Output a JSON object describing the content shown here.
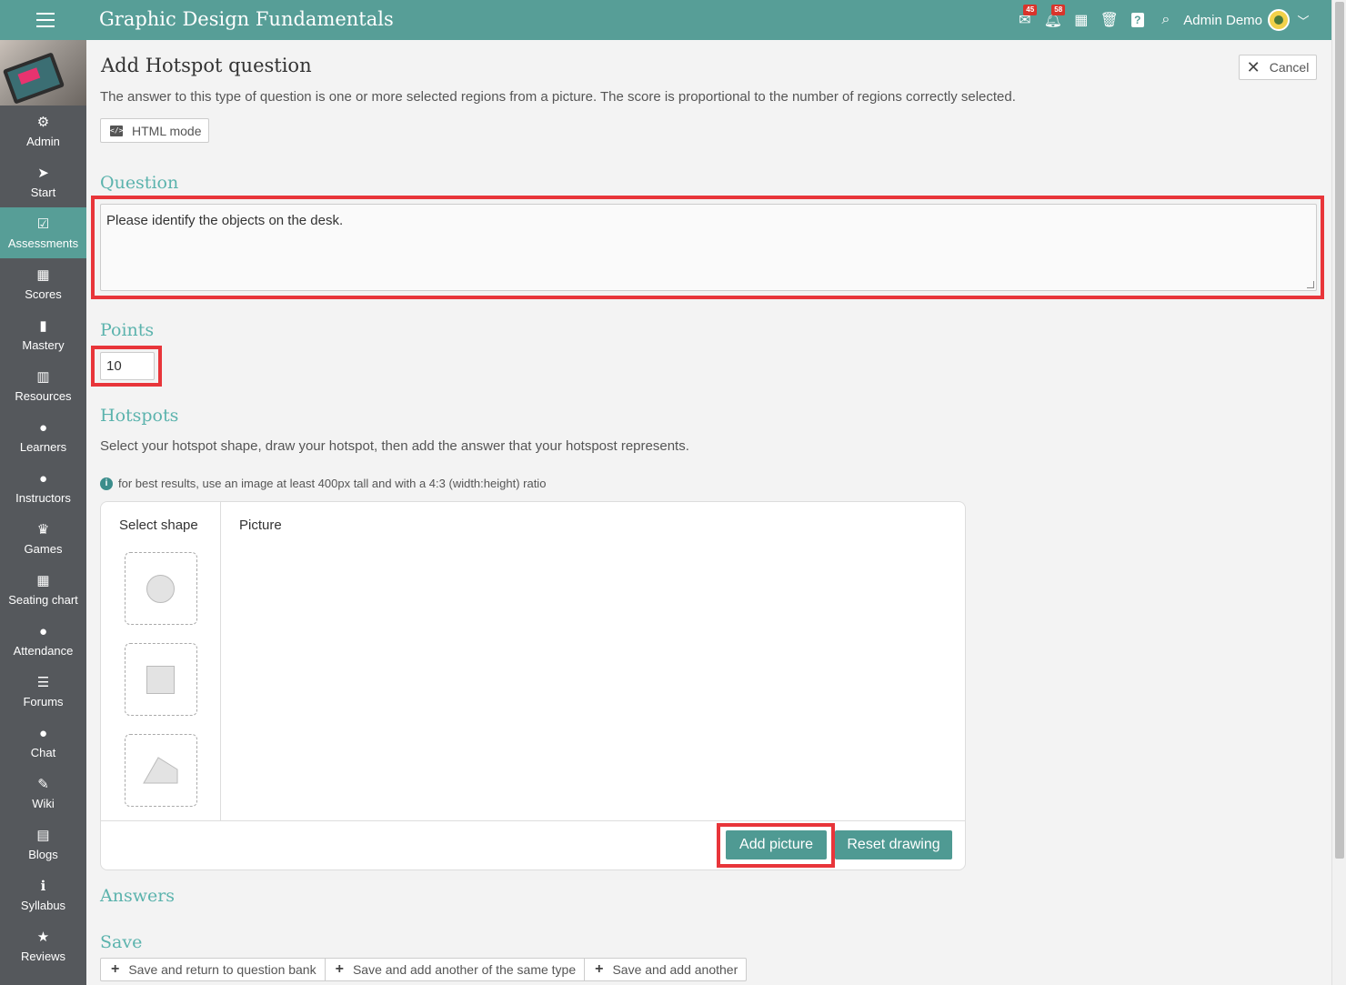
{
  "app": {
    "title": "Graphic Design Fundamentals",
    "user_name": "Admin Demo",
    "badges": {
      "messages": "45",
      "notifications": "58"
    }
  },
  "sidebar": {
    "items": [
      {
        "label": "Admin",
        "icon": "⚙"
      },
      {
        "label": "Start",
        "icon": "➤"
      },
      {
        "label": "Assessments",
        "icon": "☑"
      },
      {
        "label": "Scores",
        "icon": "▦"
      },
      {
        "label": "Mastery",
        "icon": "▮"
      },
      {
        "label": "Resources",
        "icon": "▥"
      },
      {
        "label": "Learners",
        "icon": "●"
      },
      {
        "label": "Instructors",
        "icon": "●"
      },
      {
        "label": "Games",
        "icon": "♛"
      },
      {
        "label": "Seating chart",
        "icon": "▦"
      },
      {
        "label": "Attendance",
        "icon": "●"
      },
      {
        "label": "Forums",
        "icon": "☰"
      },
      {
        "label": "Chat",
        "icon": "●"
      },
      {
        "label": "Wiki",
        "icon": "✎"
      },
      {
        "label": "Blogs",
        "icon": "▤"
      },
      {
        "label": "Syllabus",
        "icon": "ℹ"
      },
      {
        "label": "Reviews",
        "icon": "★"
      }
    ],
    "active": "Assessments"
  },
  "page": {
    "title": "Add Hotspot question",
    "cancel_label": "Cancel",
    "description": "The answer to this type of question is one or more selected regions from a picture. The score is proportional to the number of regions correctly selected.",
    "html_mode_label": "HTML mode"
  },
  "question": {
    "heading": "Question",
    "value": "Please identify the objects on the desk."
  },
  "points": {
    "heading": "Points",
    "value": "10"
  },
  "hotspots": {
    "heading": "Hotspots",
    "description": "Select your hotspot shape, draw your hotspot, then add the answer that your hotspost represents.",
    "hint": "for best results, use an image at least 400px tall and with a 4:3 (width:height) ratio",
    "select_shape_label": "Select shape",
    "picture_label": "Picture",
    "add_picture_label": "Add picture",
    "reset_drawing_label": "Reset drawing"
  },
  "answers": {
    "heading": "Answers"
  },
  "save": {
    "heading": "Save",
    "buttons": [
      "Save and return to question bank",
      "Save and add another of the same type",
      "Save and add another"
    ]
  },
  "colors": {
    "brand": "#579e97",
    "heading": "#5bb3ad",
    "highlight": "#e8353a",
    "sidebar": "#55585c"
  }
}
